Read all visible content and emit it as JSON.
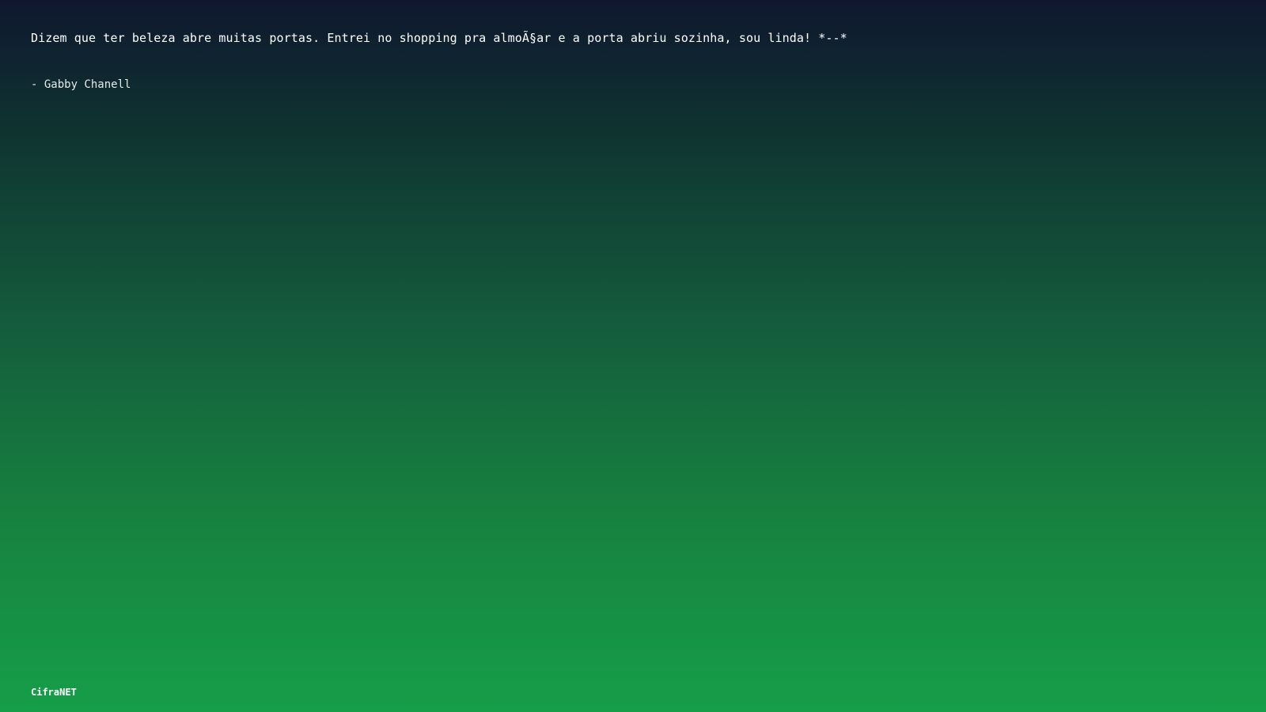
{
  "quote": {
    "text": "Dizem que ter beleza abre muitas portas. Entrei no shopping pra almoÃ§ar e a porta abriu sozinha, sou linda! *--*",
    "author": "- Gabby Chanell"
  },
  "footer": {
    "brand": "CifraNET"
  },
  "colors": {
    "gradient_top": "#0f172f",
    "gradient_bottom": "#169e48",
    "text": "#ffffff"
  }
}
